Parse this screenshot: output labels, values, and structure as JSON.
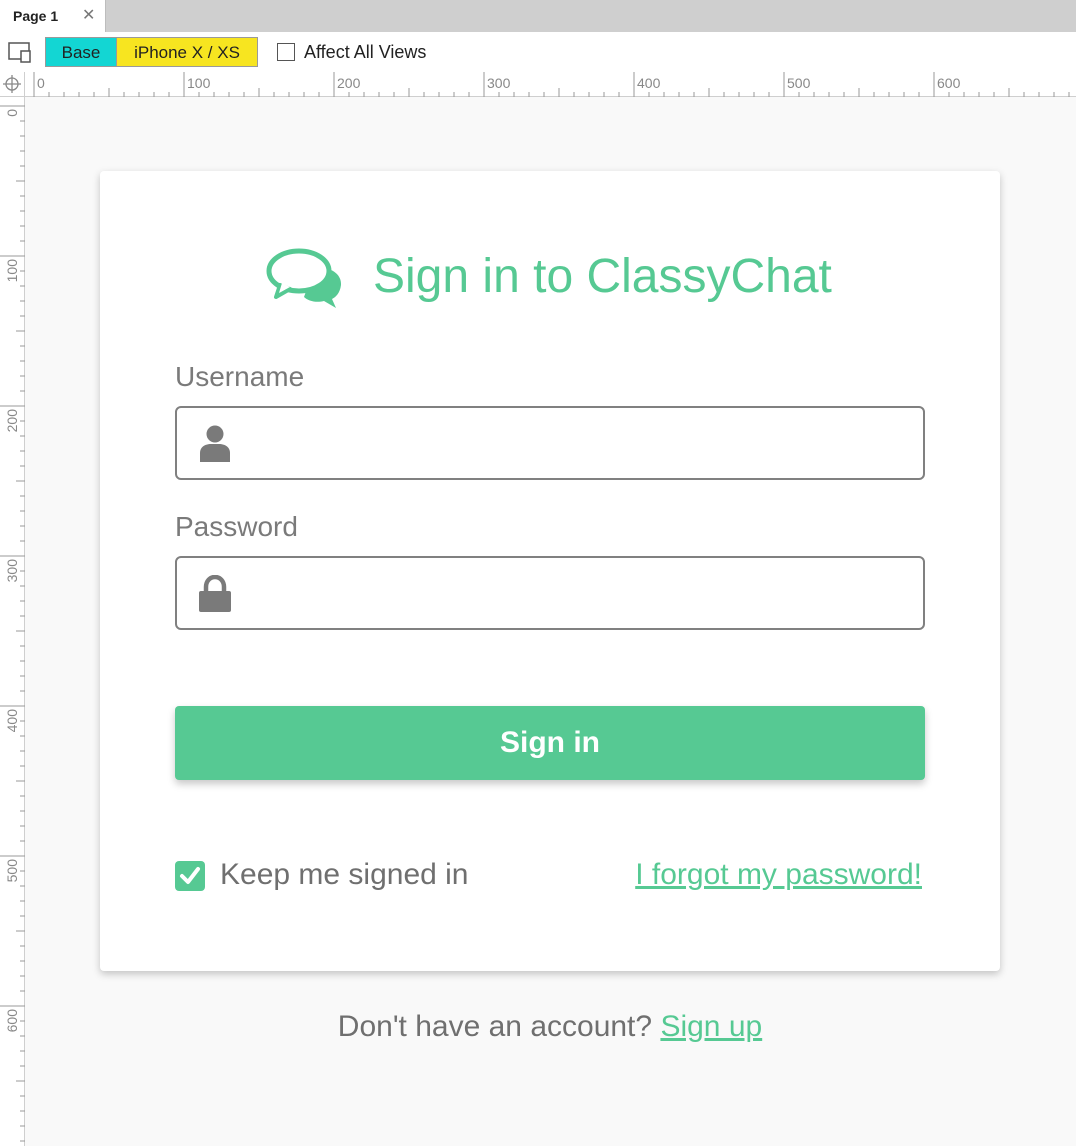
{
  "tabs": [
    {
      "label": "Page 1",
      "close_icon": "close-icon"
    }
  ],
  "toolbar": {
    "views_icon": "adaptive-views-icon",
    "views": [
      "Base",
      "iPhone X / XS"
    ],
    "affect_all_label": "Affect All Views",
    "affect_all_checked": false
  },
  "ruler": {
    "top_labels": [
      "0",
      "100",
      "200",
      "300",
      "400",
      "500",
      "600"
    ],
    "left_labels": [
      "0",
      "100",
      "200",
      "300",
      "400",
      "500",
      "600"
    ]
  },
  "card": {
    "title": "Sign in to ClassyChat",
    "title_icon": "chat-bubbles-icon",
    "username_label": "Username",
    "username_value": "",
    "username_icon": "user-icon",
    "password_label": "Password",
    "password_value": "",
    "password_icon": "lock-icon",
    "signin_label": "Sign in",
    "keep_signed_in_label": "Keep me signed in",
    "keep_signed_in_checked": true,
    "forgot_label": "I forgot my password!"
  },
  "footer": {
    "prompt": "Don't have an account?",
    "signup_label": "Sign up"
  },
  "colors": {
    "accent": "#56c993",
    "base_chip": "#13d6d3",
    "iphone_chip": "#f7e520",
    "field_border": "#808080",
    "label_gray": "#7a7a7a"
  }
}
